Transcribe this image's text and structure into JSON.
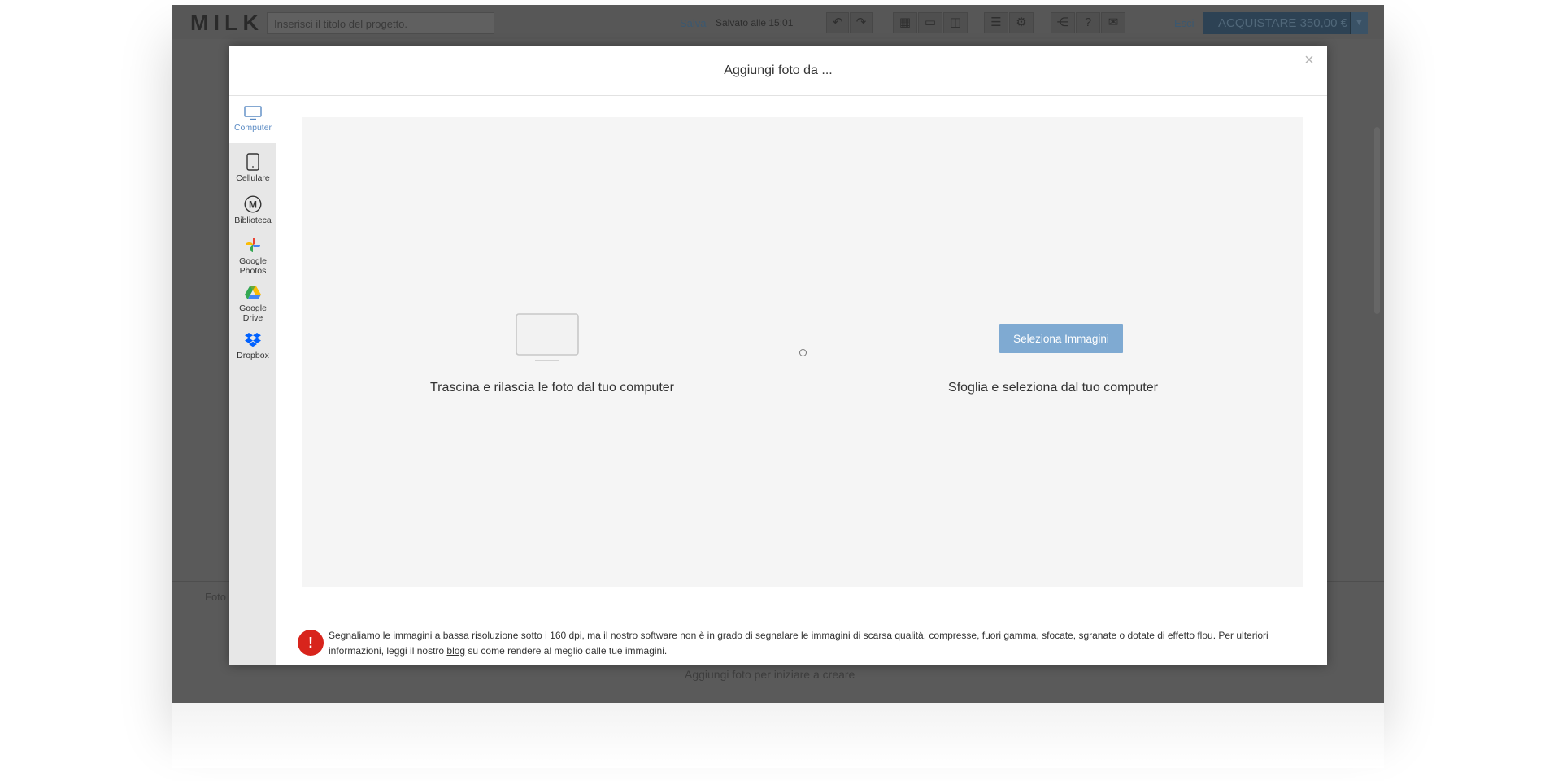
{
  "app": {
    "brand": "MILK",
    "title_placeholder": "Inserisci il titolo del progetto.",
    "save_label": "Salva",
    "saved_status": "Salvato alle 15:01",
    "exit_label": "Esci",
    "buy_label": "ACQUISTARE 350,00 €",
    "bg_tab_label": "Foto",
    "bg_add_hint": "Aggiungi foto per iniziare a creare"
  },
  "modal": {
    "title": "Aggiungi foto da ...",
    "close_symbol": "×",
    "sources": [
      {
        "label": "Computer",
        "icon": "monitor-icon",
        "active": true
      },
      {
        "label": "Cellulare",
        "icon": "phone-icon",
        "active": false
      },
      {
        "label": "Biblioteca",
        "icon": "milk-library-icon",
        "active": false
      },
      {
        "label_line1": "Google",
        "label_line2": "Photos",
        "icon": "google-photos-icon",
        "active": false
      },
      {
        "label_line1": "Google",
        "label_line2": "Drive",
        "icon": "google-drive-icon",
        "active": false
      },
      {
        "label": "Dropbox",
        "icon": "dropbox-icon",
        "active": false
      }
    ],
    "drag_text": "Trascina e rilascia le foto dal tuo computer",
    "select_button": "Seleziona Immagini",
    "browse_text": "Sfoglia e seleziona dal tuo computer",
    "warning": {
      "icon_symbol": "!",
      "text_before": "Segnaliamo le immagini a bassa risoluzione sotto i 160 dpi, ma il nostro software non è in grado di segnalare le immagini di scarsa qualità, compresse, fuori gamma, sfocate, sgranate o dotate di effetto flou. Per ulteriori informazioni, leggi il nostro ",
      "link_text": "blog",
      "text_after": " su come rendere al meglio dalle tue immagini."
    }
  },
  "colors": {
    "accent": "#7faad2",
    "active_source": "#5b8bc4",
    "warning_red": "#d8241c"
  }
}
